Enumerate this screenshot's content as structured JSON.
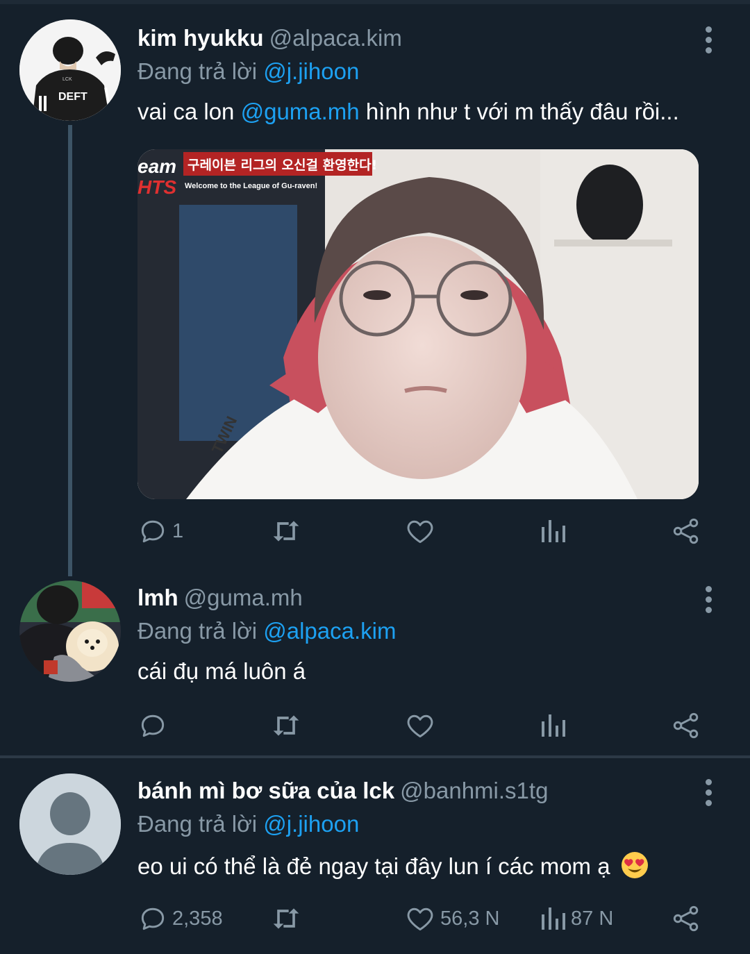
{
  "tweets": [
    {
      "name": "kim hyukku",
      "handle": "@alpaca.kim",
      "replying_label": "Đang trả lời",
      "replying_to": "@j.jihoon",
      "text_before": "vai ca lon ",
      "text_mention": "@guma.mh",
      "text_after": " hình như t với m thấy đâu rồi...",
      "avatar_jersey_text": "DEFT",
      "media_caption_ko": "구레이븐 리그의 오신걸 환영한다!",
      "media_caption_en": "Welcome to the League of Gu-raven!",
      "media_left_text_1": "eam",
      "media_left_text_2": "HTS",
      "media_shirt_text": "TWIN",
      "reply_count": "1",
      "retweet_count": "",
      "like_count": "",
      "view_count": ""
    },
    {
      "name": "lmh",
      "handle": "@guma.mh",
      "replying_label": "Đang trả lời",
      "replying_to": "@alpaca.kim",
      "text": "cái đụ má luôn á",
      "reply_count": "",
      "retweet_count": "",
      "like_count": "",
      "view_count": ""
    },
    {
      "name": "bánh mì bơ sữa của lck",
      "handle": "@banhmi.s1tg",
      "replying_label": "Đang trả lời",
      "replying_to": "@j.jihoon",
      "text": "eo ui có thể là đẻ ngay tại đây lun í các mom ạ",
      "emoji": "heart-eyes-emoji",
      "reply_count": "2,358",
      "retweet_count": "",
      "like_count": "56,3 N",
      "view_count": "87 N"
    }
  ],
  "colors": {
    "background": "#15202b",
    "secondary_text": "#8899a6",
    "mention": "#1da1f2",
    "thread_line": "#3d5466"
  },
  "icons": [
    "more-vertical-icon",
    "reply-icon",
    "retweet-icon",
    "like-icon",
    "views-icon",
    "share-icon"
  ]
}
